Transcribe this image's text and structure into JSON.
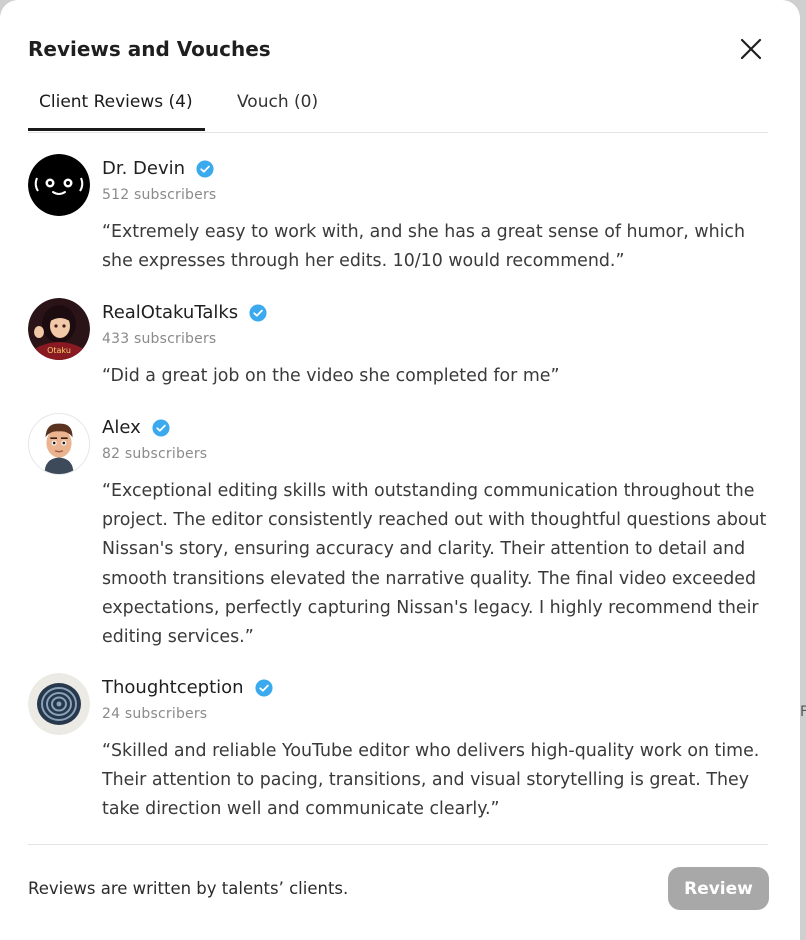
{
  "modal": {
    "title": "Reviews and Vouches"
  },
  "tabs": [
    {
      "label": "Client Reviews (4)",
      "active": true
    },
    {
      "label": "Vouch (0)",
      "active": false
    }
  ],
  "reviews": [
    {
      "name": "Dr. Devin",
      "subscribers": "512 subscribers",
      "quote": "“Extremely easy to work with, and she has a great sense of humor, which she expresses through her edits. 10/10 would recommend.”",
      "avatar_icon": "smiley-face-avatar"
    },
    {
      "name": "RealOtakuTalks",
      "subscribers": "433 subscribers",
      "quote": "“Did a great job on the video she completed for me”",
      "avatar_icon": "anime-girl-avatar"
    },
    {
      "name": "Alex",
      "subscribers": "82 subscribers",
      "quote": "“Exceptional editing skills with outstanding communication throughout the project. The editor consistently reached out with thoughtful questions about Nissan's story, ensuring accuracy and clarity. Their attention to detail and smooth transitions elevated the narrative quality. The final video exceeded expectations, perfectly capturing Nissan's legacy. I highly recommend their editing services.”",
      "avatar_icon": "cartoon-man-avatar"
    },
    {
      "name": "Thoughtception",
      "subscribers": "24 subscribers",
      "quote": "“Skilled and reliable YouTube editor who delivers high-quality work on time. Their attention to pacing, transitions, and visual storytelling is great. They take direction well and communicate clearly.”",
      "avatar_icon": "spiral-avatar"
    }
  ],
  "footer": {
    "note": "Reviews are written by talents’ clients.",
    "review_button": "Review"
  },
  "edge_text": "F",
  "colors": {
    "verified": "#3ba9ee",
    "button_disabled": "#a8a8a8",
    "text_primary": "#1f1f1f",
    "text_secondary": "#8a8a8a"
  }
}
